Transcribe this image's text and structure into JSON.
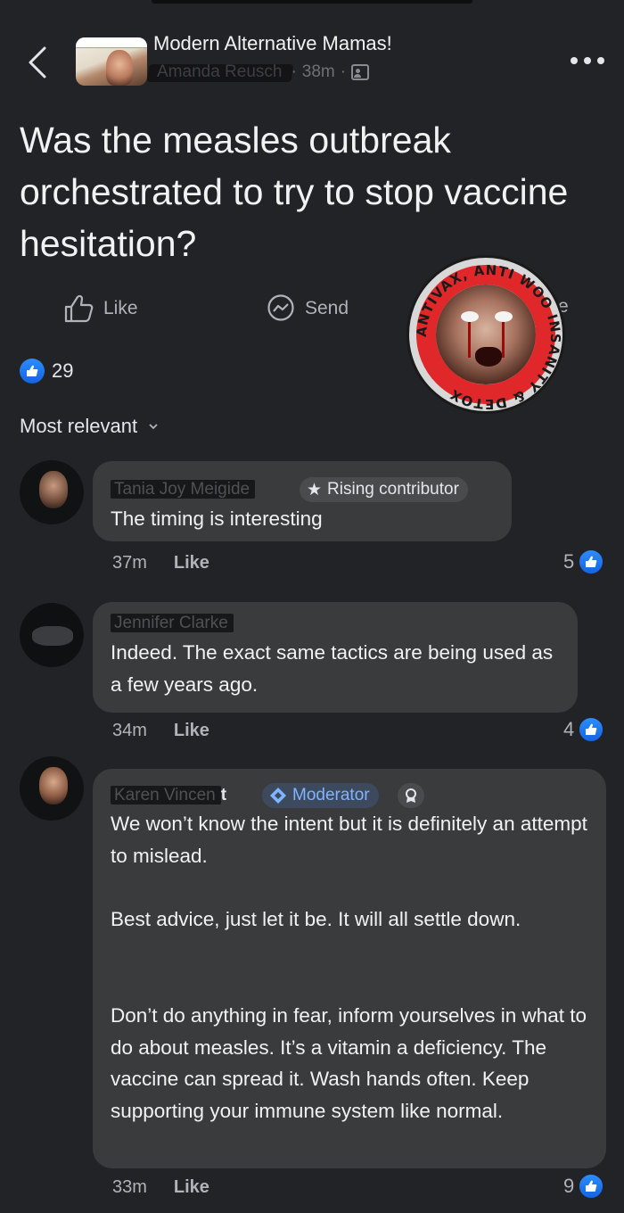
{
  "header": {
    "group_name": "Modern Alternative Mamas!",
    "author": "Amanda Reusch",
    "time": "38m",
    "separator": "·"
  },
  "post": {
    "text": "Was the measles outbreak orchestrated to try to stop vaccine hesitation?"
  },
  "actions": {
    "like": "Like",
    "send": "Send",
    "share_partial": "e"
  },
  "sticker": {
    "text": "ANTIVAX, ANTI WOO INSANITY & DETOX"
  },
  "reactions": {
    "count": "29"
  },
  "sort": {
    "label": "Most relevant"
  },
  "comments": [
    {
      "author": "Tania Joy Meigide",
      "badge": "Rising contributor",
      "text": "The timing is interesting",
      "time": "37m",
      "like": "Like",
      "reactions": "5"
    },
    {
      "author": "Jennifer Clarke",
      "text": "Indeed. The exact same tactics are being used as a few years ago.",
      "time": "34m",
      "like": "Like",
      "reactions": "4"
    },
    {
      "author": "Karen Vincen",
      "author_tail": "t",
      "badge": "Moderator",
      "paragraphs": [
        "We won’t know the intent but it is definitely an attempt to mislead.",
        "Best advice, just let it be. It will all settle down.",
        "Don’t do anything in fear, inform yourselves in what to do about measles. It’s a vitamin a deficiency. The vaccine can spread it. Wash hands often. Keep supporting your immune system like normal."
      ],
      "time": "33m",
      "like": "Like",
      "reactions": "9"
    }
  ],
  "colors": {
    "background": "#222326",
    "bubble": "#3a3b3c",
    "like_blue": "#1b74e4",
    "moderator_blue": "#7fb4ff"
  }
}
